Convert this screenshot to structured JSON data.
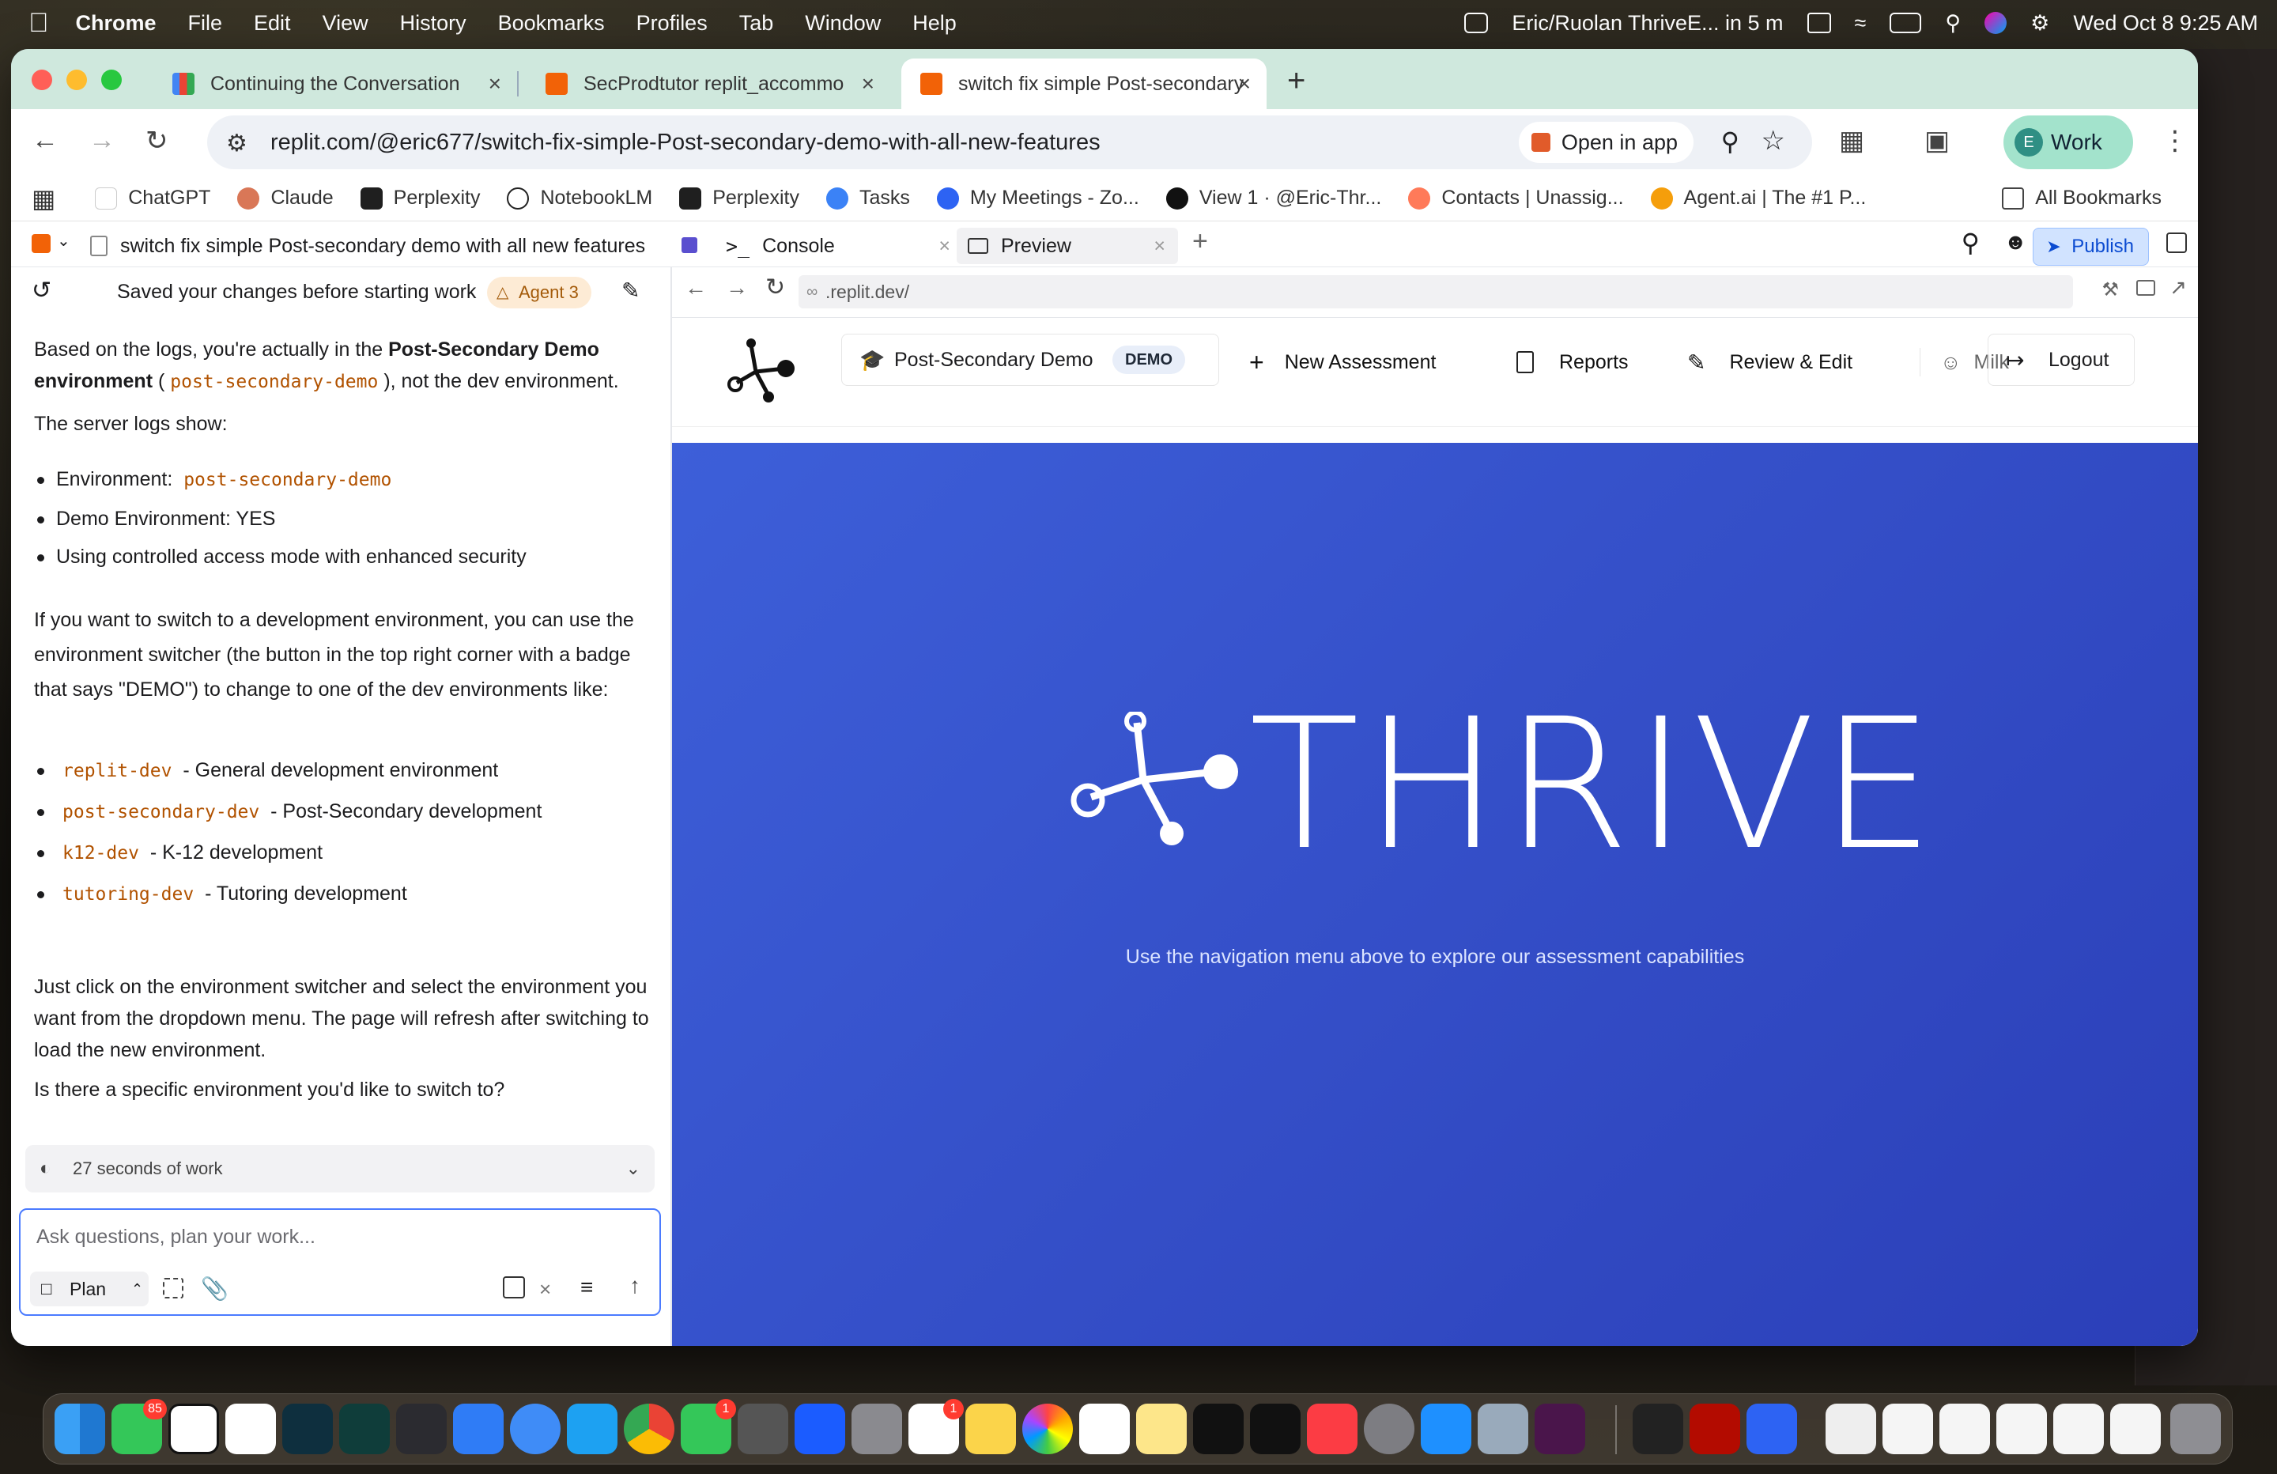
{
  "menubar": {
    "items": [
      "Chrome",
      "File",
      "Edit",
      "View",
      "History",
      "Bookmarks",
      "Profiles",
      "Tab",
      "Window",
      "Help"
    ],
    "meeting": "Eric/Ruolan ThriveE... in 5 m",
    "datetime": "Wed Oct 8  9:25 AM"
  },
  "browser": {
    "tabs": [
      {
        "title": "Continuing the Conversation",
        "icon": "gmail-icon"
      },
      {
        "title": "SecProdtutor replit_accommo",
        "icon": "replit-icon"
      },
      {
        "title": "switch fix simple Post-secondary",
        "icon": "replit-icon"
      }
    ],
    "url": "replit.com/@eric677/switch-fix-simple-Post-secondary-demo-with-all-new-features",
    "open_in_app": "Open in app",
    "profile": "Work",
    "profile_initial": "E",
    "bookmarks": [
      "ChatGPT",
      "Claude",
      "Perplexity",
      "NotebookLM",
      "Perplexity",
      "Tasks",
      "My Meetings - Zo...",
      "View 1 · @Eric-Thr...",
      "Contacts | Unassig...",
      "Agent.ai | The #1 P..."
    ],
    "all_bookmarks": "All Bookmarks"
  },
  "replit": {
    "project_title": "switch fix simple Post-secondary demo with all new features",
    "tab_console": "Console",
    "tab_preview": "Preview",
    "publish": "Publish",
    "chat": {
      "header": "Saved your changes before starting work",
      "agent_badge": "Agent 3",
      "p1_a": "Based on the logs, you're actually in the ",
      "p1_bold": "Post-Secondary Demo environment",
      "p1_code": "post-secondary-demo",
      "p1_b": "), not the dev environment.",
      "p2": "The server logs show:",
      "log1_label": "Environment:",
      "log1_code": "post-secondary-demo",
      "log2": "Demo Environment: YES",
      "log3": "Using controlled access mode with enhanced security",
      "p3": "If you want to switch to a development environment, you can use the environment switcher (the button in the top right corner with a badge that says \"DEMO\") to change to one of the dev environments like:",
      "envs": [
        {
          "code": "replit-dev",
          "desc": "- General development environment"
        },
        {
          "code": "post-secondary-dev",
          "desc": "- Post-Secondary development"
        },
        {
          "code": "k12-dev",
          "desc": "- K-12 development"
        },
        {
          "code": "tutoring-dev",
          "desc": "- Tutoring development"
        }
      ],
      "p4": "Just click on the environment switcher and select the environment you want from the dropdown menu. The page will refresh after switching to load the new environment.",
      "p5": "Is there a specific environment you'd like to switch to?",
      "work_time": "27 seconds of work",
      "input_placeholder": "Ask questions, plan your work...",
      "plan": "Plan"
    },
    "preview": {
      "address": ".replit.dev/",
      "env_label": "Post-Secondary Demo",
      "env_badge": "DEMO",
      "nav": [
        "New Assessment",
        "Reports",
        "Review & Edit"
      ],
      "user": "Milk",
      "logout": "Logout",
      "hero_title": "THRIVE",
      "hero_subtitle": "Use the navigation menu above to explore our assessment capabilities",
      "hero_color": "#3550c9"
    }
  }
}
